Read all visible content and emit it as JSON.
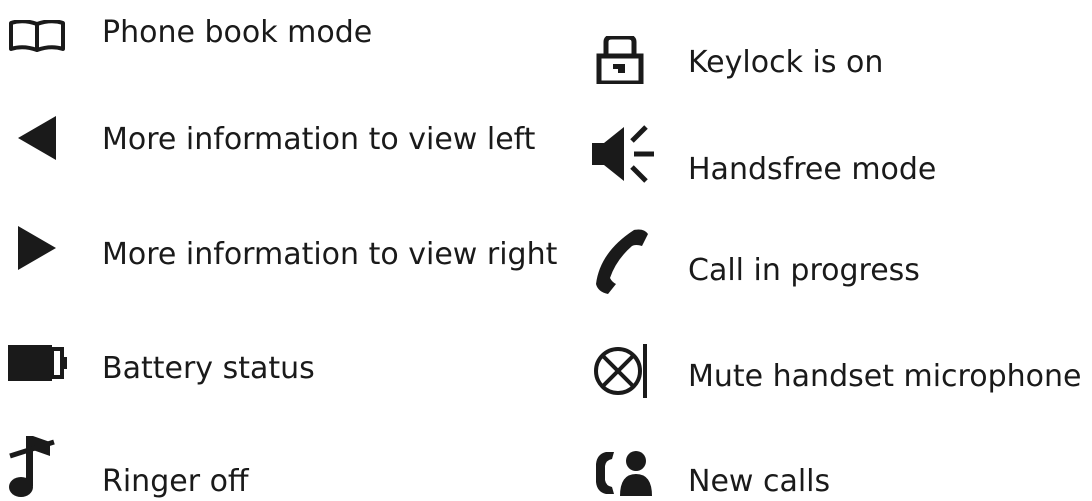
{
  "left_column": [
    {
      "label": "Phone book mode",
      "icon": "phone-book-icon"
    },
    {
      "label": "More information to view left",
      "icon": "arrow-left-icon"
    },
    {
      "label": "More information to view right",
      "icon": "arrow-right-icon"
    },
    {
      "label": "Battery status",
      "icon": "battery-icon"
    },
    {
      "label": "Ringer off",
      "icon": "ringer-off-icon"
    }
  ],
  "right_column": [
    {
      "label": "Keylock is on",
      "icon": "keylock-icon"
    },
    {
      "label": "Handsfree mode",
      "icon": "handsfree-icon"
    },
    {
      "label": "Call in progress",
      "icon": "call-in-progress-icon"
    },
    {
      "label": "Mute handset microphone",
      "icon": "mute-microphone-icon"
    },
    {
      "label": "New calls",
      "icon": "new-calls-icon"
    }
  ],
  "colors": {
    "text": "#1a1a1a",
    "icon": "#1a1a1a",
    "background": "#ffffff"
  }
}
